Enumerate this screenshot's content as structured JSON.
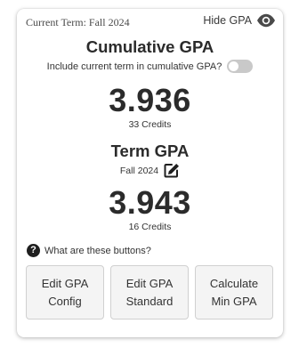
{
  "header": {
    "current_term": "Current Term: Fall 2024",
    "hide_gpa_label": "Hide GPA",
    "hide_gpa_icon": "eye-icon"
  },
  "cumulative": {
    "title": "Cumulative GPA",
    "toggle_label": "Include current term in cumulative GPA?",
    "toggle_on": false,
    "gpa": "3.936",
    "credits": "33 Credits"
  },
  "term": {
    "title": "Term GPA",
    "term_name": "Fall 2024",
    "edit_icon": "edit-icon",
    "gpa": "3.943",
    "credits": "16 Credits"
  },
  "help": {
    "label": "What are these buttons?",
    "icon": "question-circle-icon"
  },
  "buttons": {
    "edit_config": "Edit GPA Config",
    "edit_standard": "Edit GPA Standard",
    "calc_min": "Calculate Min GPA"
  },
  "colors": {
    "text": "#2b2b2b",
    "button_bg": "#f4f4f4",
    "toggle_off": "#c9c9c9"
  }
}
